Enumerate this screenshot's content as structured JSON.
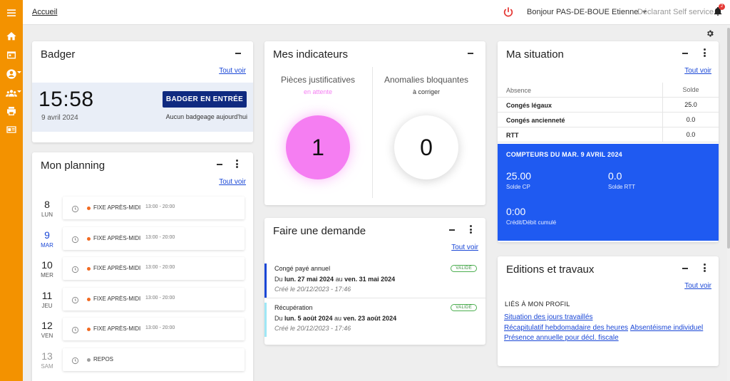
{
  "topbar": {
    "home_link": "Accueil",
    "greeting": "Bonjour PAS-DE-BOUE Etienne",
    "role": "Déclarant Self service",
    "notification_count": "2"
  },
  "sidebar": {
    "items": [
      "menu-icon",
      "home-icon",
      "calendar-icon",
      "user-icon",
      "group-icon",
      "print-icon",
      "id-card-icon"
    ]
  },
  "badger": {
    "title": "Badger",
    "see_all": "Tout voir",
    "time": "15:58",
    "date": "9 avril 2024",
    "button": "BADGER EN ENTRÉE",
    "no_badge": "Aucun badgeage aujourd'hui"
  },
  "planning": {
    "title": "Mon planning",
    "see_all": "Tout voir",
    "days": [
      {
        "num": "8",
        "label": "LUN",
        "type": "FIXE APRÈS-MIDI",
        "hours": "13:00 - 20:00",
        "dot": "#f26a21",
        "num_color": "#222",
        "label_color": "#555"
      },
      {
        "num": "9",
        "label": "MAR",
        "type": "FIXE APRÈS-MIDI",
        "hours": "13:00 - 20:00",
        "dot": "#f26a21",
        "num_color": "#1a47d6",
        "label_color": "#1a47d6"
      },
      {
        "num": "10",
        "label": "MER",
        "type": "FIXE APRÈS-MIDI",
        "hours": "13:00 - 20:00",
        "dot": "#f26a21",
        "num_color": "#222",
        "label_color": "#555"
      },
      {
        "num": "11",
        "label": "JEU",
        "type": "FIXE APRÈS-MIDI",
        "hours": "13:00 - 20:00",
        "dot": "#f26a21",
        "num_color": "#222",
        "label_color": "#555"
      },
      {
        "num": "12",
        "label": "VEN",
        "type": "FIXE APRÈS-MIDI",
        "hours": "13:00 - 20:00",
        "dot": "#f26a21",
        "num_color": "#222",
        "label_color": "#555"
      },
      {
        "num": "13",
        "label": "SAM",
        "type": "REPOS",
        "hours": "",
        "dot": "#9e9e9e",
        "num_color": "#999",
        "label_color": "#999"
      }
    ]
  },
  "indicators": {
    "title": "Mes indicateurs",
    "left": {
      "title": "Pièces justificatives",
      "sub": "en attente",
      "sub_color": "#f57ef2",
      "value": "1",
      "circle_color": "#f57ef2"
    },
    "right": {
      "title": "Anomalies bloquantes",
      "sub": "à corriger",
      "sub_color": "#333",
      "value": "0",
      "circle_color": "#ffffff"
    }
  },
  "demande": {
    "title": "Faire une demande",
    "see_all": "Tout voir",
    "items": [
      {
        "type": "Congé payé annuel",
        "from_prefix": "Du ",
        "from": "lun. 27 mai 2024",
        "to_prefix": " au ",
        "to": "ven. 31 mai 2024",
        "created": "Créé le 20/12/2023 - 17:46",
        "badge": "VALIDÉ",
        "bar_color": "#1a47d6"
      },
      {
        "type": "Récupération",
        "from_prefix": "Du ",
        "from": "lun. 5 août 2024",
        "to_prefix": " au ",
        "to": "ven. 23 août 2024",
        "created": "Créé le 20/12/2023 - 17:46",
        "badge": "VALIDÉ",
        "bar_color": "#9ee7f5"
      }
    ]
  },
  "situation": {
    "title": "Ma situation",
    "see_all": "Tout voir",
    "headers": [
      "Absence",
      "Solde"
    ],
    "rows": [
      {
        "label": "Congés légaux",
        "value": "25.0"
      },
      {
        "label": "Congés ancienneté",
        "value": "0.0"
      },
      {
        "label": "RTT",
        "value": "0.0"
      }
    ],
    "counters": {
      "title": "COMPTEURS DU MAR. 9 AVRIL 2024",
      "cp_value": "25.00",
      "cp_label": "Solde CP",
      "rtt_value": "0.0",
      "rtt_label": "Solde RTT",
      "cumul_value": "0:00",
      "cumul_label": "Crédit/Débit cumulé"
    }
  },
  "editions": {
    "title": "Editions et travaux",
    "see_all": "Tout voir",
    "section": "LIÉS À MON PROFIL",
    "links": [
      "Situation des jours travaillés",
      "Récapitulatif hebdomadaire des heures",
      "Absentéisme individuel",
      "Présence annuelle pour décl. fiscale"
    ]
  },
  "colors": {
    "sidebar": "#f39200",
    "badger_button": "#0f2a80",
    "counters_panel": "#1f5af1",
    "link": "#1a47d6"
  }
}
